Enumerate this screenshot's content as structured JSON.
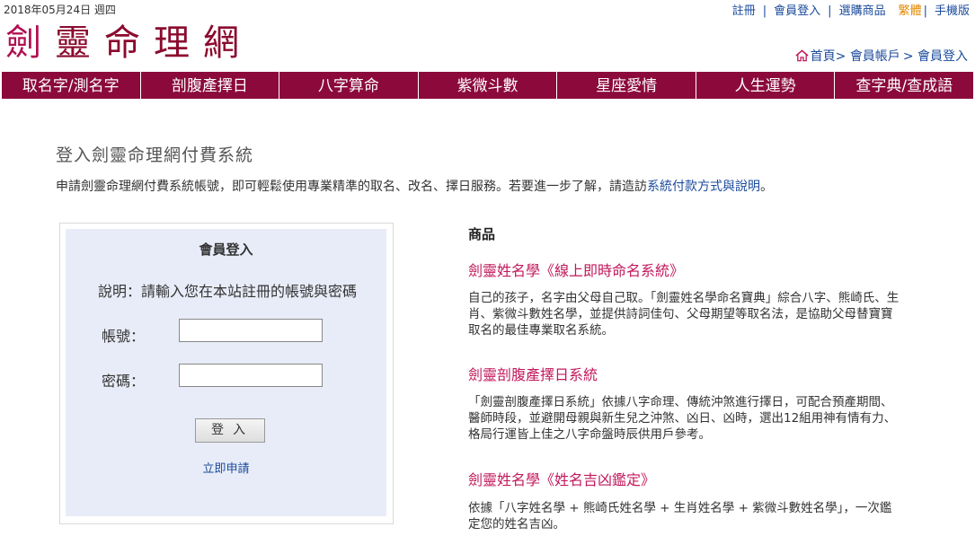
{
  "topbar": {
    "date": "2018年05月24日 週四",
    "links": [
      "註冊",
      "會員登入",
      "選購商品",
      "繁體",
      "手機版"
    ]
  },
  "logo": {
    "chars": [
      "劍",
      "靈",
      "命",
      "理",
      "網"
    ]
  },
  "breadcrumb": {
    "home": "首頁",
    "sep": "> ",
    "account": "會員帳戶",
    "current": "會員登入"
  },
  "nav": {
    "items": [
      "取名字/測名字",
      "剖腹產擇日",
      "八字算命",
      "紫微斗數",
      "星座愛情",
      "人生運勢",
      "查字典/查成語"
    ]
  },
  "main": {
    "title": "登入劍靈命理網付費系統",
    "intro_prefix": "申請劍靈命理網付費系統帳號，即可輕鬆使用專業精準的取名、改名、擇日服務。若要進一步了解，請造訪",
    "intro_link": "系統付款方式與說明",
    "intro_suffix": "。"
  },
  "login": {
    "title": "會員登入",
    "description": "說明：請輸入您在本站註冊的帳號與密碼",
    "account_label": "帳號：",
    "password_label": "密碼：",
    "account_value": "",
    "password_value": "",
    "submit_label": "登入",
    "apply_label": "立即申請"
  },
  "products": {
    "heading": "商品",
    "items": [
      {
        "title": "劍靈姓名學《線上即時命名系統》",
        "desc": "自己的孩子，名字由父母自己取。「劍靈姓名學命名寶典」綜合八字、熊崎氏、生肖、紫微斗數姓名學，並提供詩詞佳句、父母期望等取名法，是協助父母替寶寶取名的最佳專業取名系統。"
      },
      {
        "title": "劍靈剖腹產擇日系統",
        "desc": "「劍靈剖腹產擇日系統」依據八字命理、傳統沖煞進行擇日，可配合預產期間、醫師時段，並避開母親與新生兒之沖煞、凶日、凶時，選出12組用神有情有力、格局行運皆上佳之八字命盤時辰供用戶參考。"
      },
      {
        "title": "劍靈姓名學《姓名吉凶鑑定》",
        "desc": "依據「八字姓名學 + 熊崎氏姓名學 + 生肖姓名學 + 紫微斗數姓名學」，一次鑑定您的姓名吉凶。"
      }
    ]
  },
  "colors": {
    "nav_bg": "#8b0a3b",
    "link": "#1a4a9c",
    "product_title": "#c2185b",
    "login_bg": "#e8ecf8",
    "active_lang": "#e08a00"
  }
}
